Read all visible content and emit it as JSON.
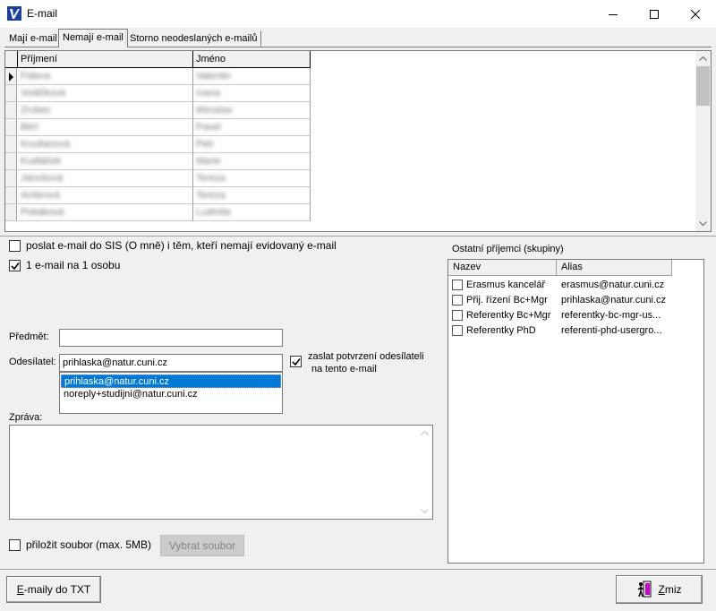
{
  "window": {
    "title": "E-mail"
  },
  "tabs": [
    {
      "label": "Mají e-mail"
    },
    {
      "label": "Nemají e-mail"
    },
    {
      "label": "Storno neodeslaných e-mailů"
    }
  ],
  "grid": {
    "columns": [
      "Příjmení",
      "Jméno"
    ],
    "rows": [
      [
        "Fideva",
        "Valentin"
      ],
      [
        "Vodičková",
        "Ivana"
      ],
      [
        "Zrubec",
        "Miroslav"
      ],
      [
        "Bérl",
        "Pavel"
      ],
      [
        "Knutlanová",
        "Petr"
      ],
      [
        "Kudláček",
        "Marie"
      ],
      [
        "Jánošová",
        "Tereza"
      ],
      [
        "Ambrová",
        "Tereza"
      ],
      [
        "Pokáková",
        "Ludmila"
      ]
    ]
  },
  "options": {
    "send_sis": {
      "label": "poslat e-mail do SIS (O mně) i těm, kteří nemají evidovaný e-mail",
      "checked": false
    },
    "one_per_person": {
      "label": "1 e-mail na 1 osobu",
      "checked": true
    }
  },
  "form": {
    "subject_label": "Předmět:",
    "subject_value": "",
    "sender_label": "Odesílatel:",
    "sender_value": "prihlaska@natur.cuni.cz",
    "sender_options": [
      "prihlaska@natur.cuni.cz",
      "noreply+studijni@natur.cuni.cz"
    ],
    "confirm_label_line1": "zaslat potvrzení odesílateli",
    "confirm_label_line2": "na tento e-mail",
    "confirm_checked": true,
    "message_label": "Zpráva:",
    "message_value": "",
    "attach_label": "přiložit soubor (max. 5MB)",
    "attach_checked": false,
    "choose_file_label": "Vybrat soubor"
  },
  "recipients": {
    "title": "Ostatní příjemci (skupiny)",
    "columns": [
      "Nazev",
      "Alias"
    ],
    "rows": [
      {
        "name": "Erasmus kancelář",
        "alias": "erasmus@natur.cuni.cz"
      },
      {
        "name": "Přij. řízení Bc+Mgr",
        "alias": "prihlaska@natur.cuni.cz"
      },
      {
        "name": "Referentky Bc+Mgr",
        "alias": "referentky-bc-mgr-us..."
      },
      {
        "name": "Referentky PhD",
        "alias": "referenti-phd-usergro..."
      }
    ]
  },
  "footer": {
    "export_label": "E-maily do TXT",
    "export_mnemonic": "E",
    "export_rest": "-maily do TXT",
    "cancel_label": "Zmiz",
    "cancel_mnemonic": "Z",
    "cancel_rest": "miz"
  },
  "colors": {
    "selection": "#0078d7",
    "window_bg": "#f0f0f0"
  }
}
